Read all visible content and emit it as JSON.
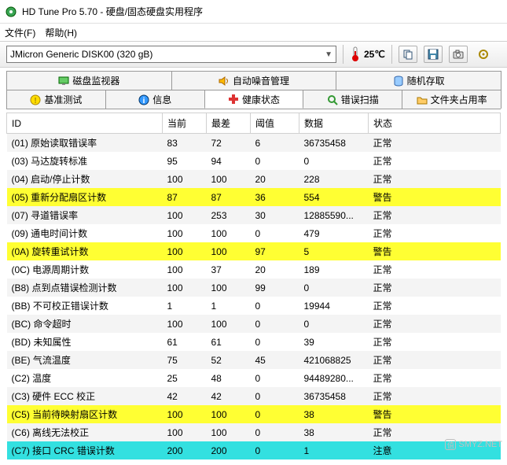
{
  "titlebar": {
    "text": "HD Tune Pro 5.70 - 硬盘/固态硬盘实用程序"
  },
  "menubar": {
    "file": "文件(F)",
    "help": "帮助(H)"
  },
  "toolbar": {
    "disk": "JMicron Generic DISK00 (320 gB)",
    "temp": "25℃"
  },
  "tabs": {
    "row1": [
      {
        "icon": "monitor",
        "label": "磁盘监视器"
      },
      {
        "icon": "speaker",
        "label": "自动噪音管理"
      },
      {
        "icon": "db",
        "label": "随机存取"
      }
    ],
    "row2": [
      {
        "icon": "info-yellow",
        "label": "基准测试"
      },
      {
        "icon": "info-blue",
        "label": "信息"
      },
      {
        "icon": "health",
        "label": "健康状态",
        "selected": true
      },
      {
        "icon": "scan",
        "label": "错误扫描"
      },
      {
        "icon": "folder",
        "label": "文件夹占用率"
      }
    ]
  },
  "table": {
    "headers": {
      "id": "ID",
      "cur": "当前",
      "worst": "最差",
      "thr": "阈值",
      "data": "数据",
      "stat": "状态"
    },
    "rows": [
      {
        "id": "(01) 原始读取错误率",
        "cur": "83",
        "worst": "72",
        "thr": "6",
        "data": "36735458",
        "stat": "正常",
        "cls": ""
      },
      {
        "id": "(03) 马达旋转标准",
        "cur": "95",
        "worst": "94",
        "thr": "0",
        "data": "0",
        "stat": "正常",
        "cls": ""
      },
      {
        "id": "(04) 启动/停止计数",
        "cur": "100",
        "worst": "100",
        "thr": "20",
        "data": "228",
        "stat": "正常",
        "cls": ""
      },
      {
        "id": "(05) 重新分配扇区计数",
        "cur": "87",
        "worst": "87",
        "thr": "36",
        "data": "554",
        "stat": "警告",
        "cls": "warn"
      },
      {
        "id": "(07) 寻道错误率",
        "cur": "100",
        "worst": "253",
        "thr": "30",
        "data": "12885590...",
        "stat": "正常",
        "cls": ""
      },
      {
        "id": "(09) 通电时间计数",
        "cur": "100",
        "worst": "100",
        "thr": "0",
        "data": "479",
        "stat": "正常",
        "cls": ""
      },
      {
        "id": "(0A) 旋转重试计数",
        "cur": "100",
        "worst": "100",
        "thr": "97",
        "data": "5",
        "stat": "警告",
        "cls": "warn"
      },
      {
        "id": "(0C) 电源周期计数",
        "cur": "100",
        "worst": "37",
        "thr": "20",
        "data": "189",
        "stat": "正常",
        "cls": ""
      },
      {
        "id": "(B8) 点到点错误检测计数",
        "cur": "100",
        "worst": "100",
        "thr": "99",
        "data": "0",
        "stat": "正常",
        "cls": ""
      },
      {
        "id": "(BB) 不可校正错误计数",
        "cur": "1",
        "worst": "1",
        "thr": "0",
        "data": "19944",
        "stat": "正常",
        "cls": ""
      },
      {
        "id": "(BC) 命令超时",
        "cur": "100",
        "worst": "100",
        "thr": "0",
        "data": "0",
        "stat": "正常",
        "cls": ""
      },
      {
        "id": "(BD) 未知属性",
        "cur": "61",
        "worst": "61",
        "thr": "0",
        "data": "39",
        "stat": "正常",
        "cls": ""
      },
      {
        "id": "(BE) 气流温度",
        "cur": "75",
        "worst": "52",
        "thr": "45",
        "data": "421068825",
        "stat": "正常",
        "cls": ""
      },
      {
        "id": "(C2) 温度",
        "cur": "25",
        "worst": "48",
        "thr": "0",
        "data": "94489280...",
        "stat": "正常",
        "cls": ""
      },
      {
        "id": "(C3) 硬件 ECC 校正",
        "cur": "42",
        "worst": "42",
        "thr": "0",
        "data": "36735458",
        "stat": "正常",
        "cls": ""
      },
      {
        "id": "(C5) 当前待映射扇区计数",
        "cur": "100",
        "worst": "100",
        "thr": "0",
        "data": "38",
        "stat": "警告",
        "cls": "warn"
      },
      {
        "id": "(C6) 离线无法校正",
        "cur": "100",
        "worst": "100",
        "thr": "0",
        "data": "38",
        "stat": "正常",
        "cls": ""
      },
      {
        "id": "(C7) 接口 CRC 错误计数",
        "cur": "200",
        "worst": "200",
        "thr": "0",
        "data": "1",
        "stat": "注意",
        "cls": "attn"
      }
    ]
  },
  "watermark": "SMYZ.NET"
}
